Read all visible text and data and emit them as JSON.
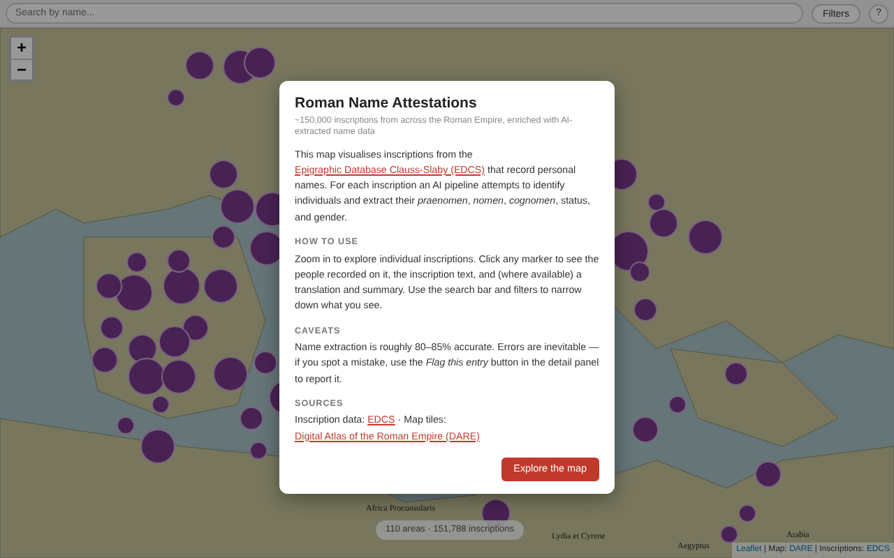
{
  "search": {
    "placeholder": "Search by name..."
  },
  "toolbar_buttons": [
    "Filters",
    "?"
  ],
  "zoom_controls": [
    "+",
    "−"
  ],
  "map_labels": [
    "Africa Proconsularis",
    "Aegyptus",
    "Arabia",
    "Lydia et Cyrene"
  ],
  "count_label": "110 areas · 151,788 inscriptions",
  "attribution": [
    {
      "kind": "link",
      "text": "Leaflet"
    },
    {
      "kind": "text",
      "text": " | Map: "
    },
    {
      "kind": "link",
      "text": "DARE"
    },
    {
      "kind": "text",
      "text": " | Inscriptions: "
    },
    {
      "kind": "link",
      "text": "EDCS"
    }
  ],
  "dialog": {
    "title": "Roman Name Attestations",
    "subtitle": "~150,000 inscriptions from across the Roman Empire, enriched with AI-extracted name data",
    "intro": [
      {
        "kind": "text",
        "text": "This map visualises inscriptions from the "
      },
      {
        "kind": "link",
        "text": "Epigraphic Database Clauss-Slaby (EDCS)"
      },
      {
        "kind": "text",
        "text": " that record personal names. For each inscription an AI pipeline attempts to identify individuals and extract their *praenomen*, *nomen*, *cognomen*, status, and gender."
      }
    ],
    "sections": [
      {
        "heading": "HOW TO USE",
        "body": [
          {
            "kind": "text",
            "text": "Zoom in to explore individual inscriptions. Click any marker to see the people recorded on it, the inscription text, and (where available) a translation and summary. Use the search bar and filters to narrow down what you see."
          }
        ]
      },
      {
        "heading": "CAVEATS",
        "body": [
          {
            "kind": "text",
            "text": "Name extraction is roughly 80–85% accurate. Errors are inevitable — if you spot a mistake, use the *Flag this entry* button in the detail panel to report it."
          }
        ]
      },
      {
        "heading": "SOURCES",
        "body": [
          {
            "kind": "text",
            "text": "Inscription data: "
          },
          {
            "kind": "link",
            "text": "EDCS"
          },
          {
            "kind": "text",
            "text": " · Map tiles: "
          },
          {
            "kind": "link",
            "text": "Digital Atlas of the Roman Empire (DARE)"
          }
        ]
      }
    ],
    "button": "Explore the map"
  }
}
